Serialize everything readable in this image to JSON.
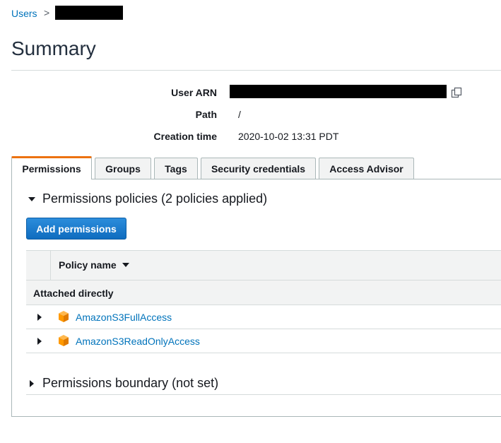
{
  "breadcrumb": {
    "users_link": "Users",
    "separator": ">"
  },
  "page": {
    "title": "Summary"
  },
  "details": {
    "user_arn_label": "User ARN",
    "path_label": "Path",
    "path_value": "/",
    "creation_time_label": "Creation time",
    "creation_time_value": "2020-10-02 13:31 PDT"
  },
  "tabs": [
    {
      "label": "Permissions",
      "active": true
    },
    {
      "label": "Groups",
      "active": false
    },
    {
      "label": "Tags",
      "active": false
    },
    {
      "label": "Security credentials",
      "active": false
    },
    {
      "label": "Access Advisor",
      "active": false
    }
  ],
  "permissions": {
    "policies_section_title": "Permissions policies (2 policies applied)",
    "add_button": "Add permissions",
    "table": {
      "column_header": "Policy name",
      "group_label": "Attached directly",
      "rows": [
        {
          "name": "AmazonS3FullAccess",
          "icon": "aws-managed-policy-cube-icon"
        },
        {
          "name": "AmazonS3ReadOnlyAccess",
          "icon": "aws-managed-policy-cube-icon"
        }
      ]
    },
    "boundary_section_title": "Permissions boundary (not set)"
  },
  "colors": {
    "link": "#0073bb",
    "active_tab_accent": "#ec7211",
    "primary_button": "#0f6cbf",
    "policy_icon": "#f90"
  }
}
